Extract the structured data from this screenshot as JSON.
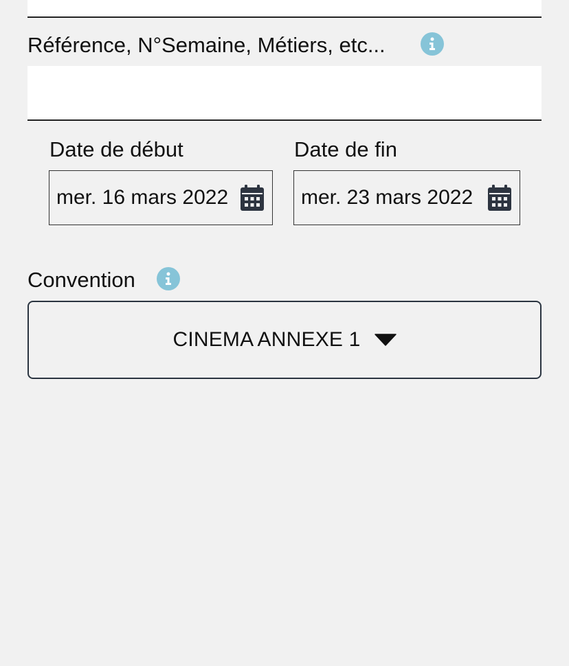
{
  "form": {
    "reference": {
      "label": "Référence, N°Semaine, Métiers, etc...",
      "value": "",
      "info_icon": "info-icon"
    },
    "start_date": {
      "label": "Date de début",
      "value": "mer. 16 mars 2022",
      "icon": "calendar-icon"
    },
    "end_date": {
      "label": "Date de fin",
      "value": "mer. 23 mars 2022",
      "icon": "calendar-icon"
    },
    "convention": {
      "label": "Convention",
      "selected": "CINEMA ANNEXE 1",
      "info_icon": "info-icon",
      "dropdown_icon": "caret-down-icon"
    }
  },
  "colors": {
    "background": "#f1f1f1",
    "info_icon": "#86c4d8",
    "calendar_icon": "#2d3440",
    "select_border": "#2a3440"
  }
}
